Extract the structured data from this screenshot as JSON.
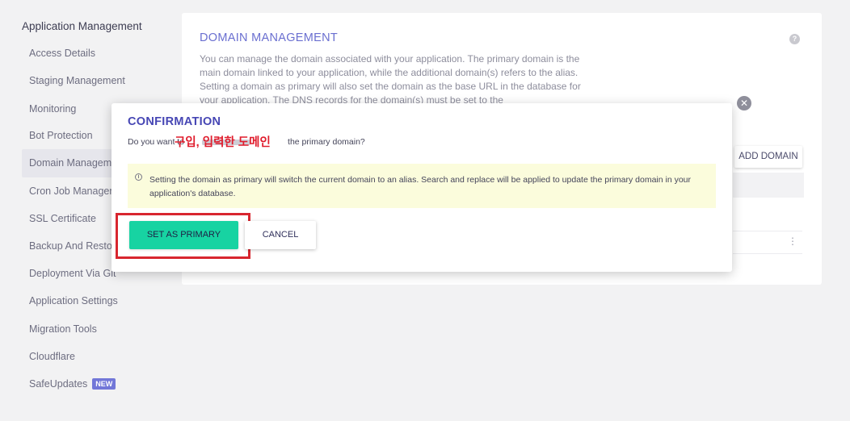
{
  "sidebar": {
    "title": "Application Management",
    "items": [
      {
        "label": "Access Details"
      },
      {
        "label": "Staging Management"
      },
      {
        "label": "Monitoring"
      },
      {
        "label": "Bot Protection"
      },
      {
        "label": "Domain Management",
        "active": true
      },
      {
        "label": "Cron Job Management"
      },
      {
        "label": "SSL Certificate"
      },
      {
        "label": "Backup And Restore"
      },
      {
        "label": "Deployment Via Git"
      },
      {
        "label": "Application Settings"
      },
      {
        "label": "Migration Tools"
      },
      {
        "label": "Cloudflare"
      },
      {
        "label": "SafeUpdates",
        "badge": "NEW"
      }
    ]
  },
  "domain_management": {
    "title": "DOMAIN MANAGEMENT",
    "description": "You can manage the domain associated with your application. The primary domain is the main domain linked to your application, while the additional domain(s) refers to the alias. Setting a domain as primary will also set the domain as the base URL in the database for your application. The DNS records for the domain(s) must be set to the",
    "help_icon": "question-circle-icon",
    "add_domain_label": "ADD DOMAIN",
    "row_menu_icon": "kebab-menu-icon"
  },
  "close_icon": "close-icon",
  "modal": {
    "title": "CONFIRMATION",
    "question_prefix": "Do you want to",
    "question_suffix": "the primary domain?",
    "redaction_annotation": "구입, 입력한 도메인",
    "notice_icon": "info-icon",
    "notice_text": "Setting the domain as primary will switch the current domain to an alias. Search and replace will be applied to update the primary domain in your application's database.",
    "primary_button": "SET AS PRIMARY",
    "cancel_button": "CANCEL"
  },
  "colors": {
    "accent": "#6a6fd0",
    "modal_title": "#4646b4",
    "primary_button": "#17d3a2",
    "notice_bg": "#fbfcdc",
    "highlight": "#d8262f",
    "badge": "#7277d8"
  }
}
